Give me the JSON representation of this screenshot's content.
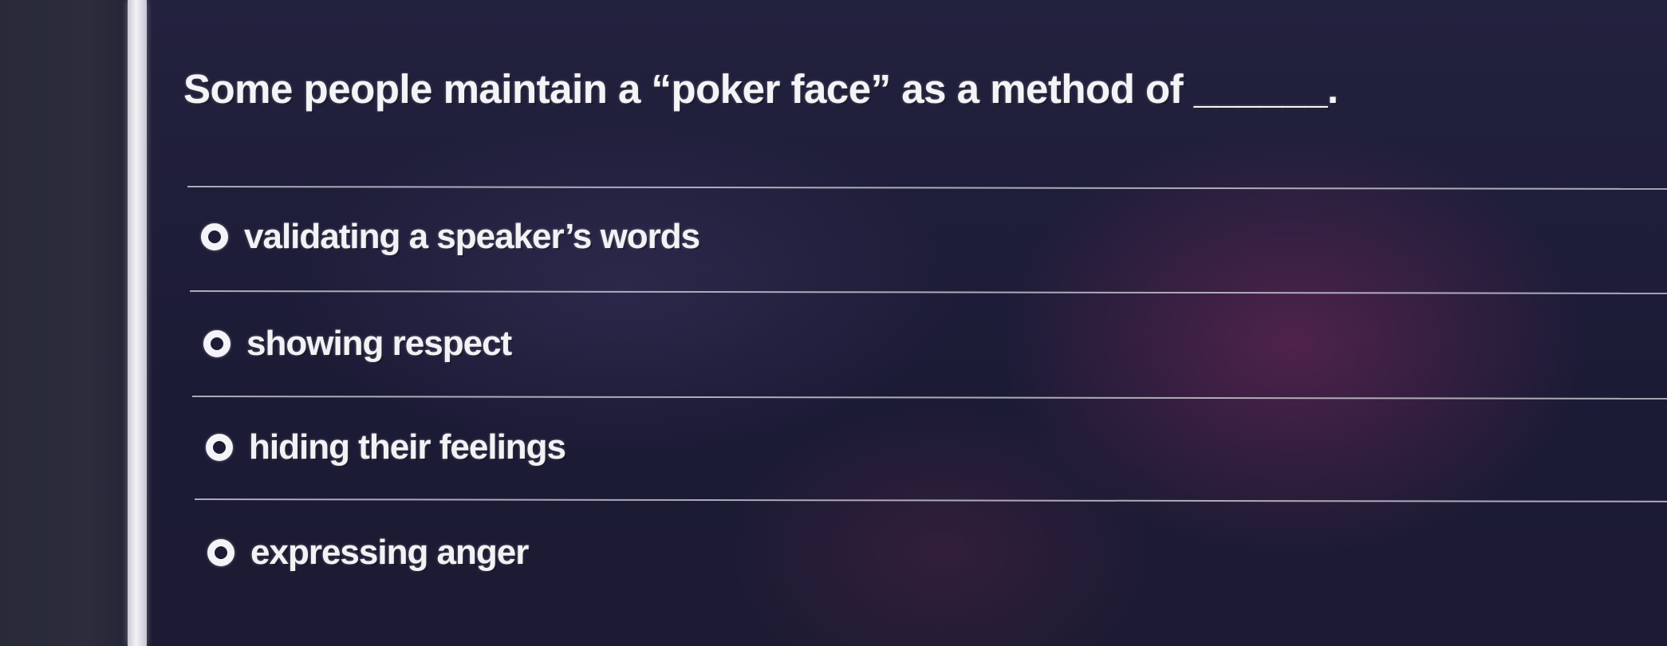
{
  "question": {
    "text": "Some people maintain a “poker face” as a method of ______."
  },
  "options": [
    {
      "label": "validating a speaker’s words",
      "selected": false
    },
    {
      "label": "showing respect",
      "selected": false
    },
    {
      "label": "hiding their feelings",
      "selected": false
    },
    {
      "label": "expressing anger",
      "selected": false
    }
  ],
  "colors": {
    "background": "#1e1d38",
    "text": "#f4f4f8",
    "divider": "#c4c4cf",
    "left_border": "#f2f2f6"
  }
}
